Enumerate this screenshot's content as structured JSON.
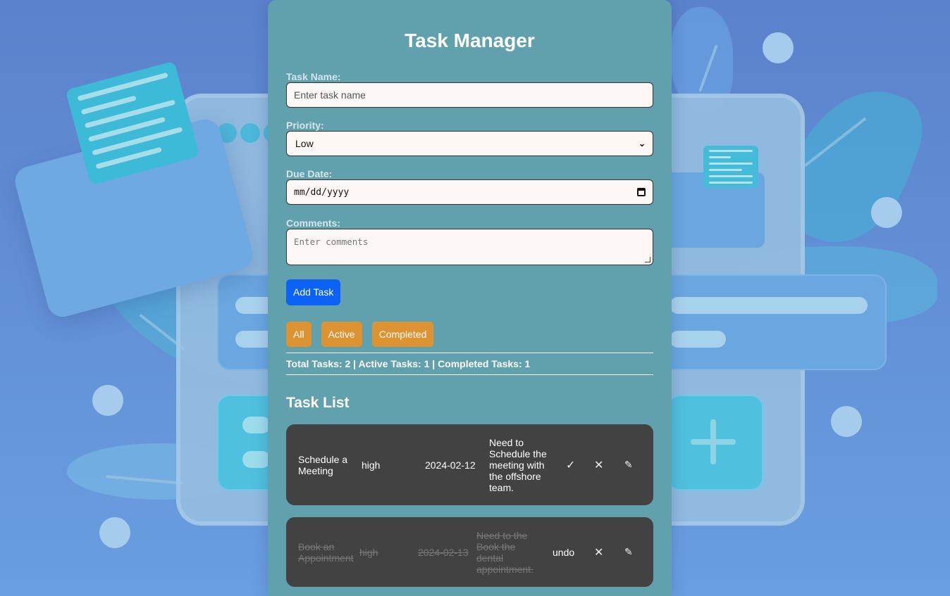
{
  "app": {
    "title": "Task Manager"
  },
  "form": {
    "task_name_label": "Task Name:",
    "task_name_placeholder": "Enter task name",
    "priority_label": "Priority:",
    "priority_value": "Low",
    "due_date_label": "Due Date:",
    "due_date_placeholder": "mm/dd/yyyy",
    "comments_label": "Comments:",
    "comments_placeholder": "Enter comments",
    "add_button": "Add Task"
  },
  "filters": [
    "All",
    "Active",
    "Completed"
  ],
  "stats": "Total Tasks: 2 | Active Tasks: 1 | Completed Tasks: 1",
  "task_list": {
    "title": "Task List",
    "tasks": [
      {
        "name": "Schedule a Meeting",
        "priority": "high",
        "due_date": "2024-02-12",
        "comments": "Need to Schedule the meeting with the offshore team.",
        "status_action": "✓",
        "completed": false
      },
      {
        "name": "Book an Appointment",
        "priority": "high",
        "due_date": "2024-02-13",
        "comments": "Need to the Book the dental appointment.",
        "status_action": "undo",
        "completed": true
      }
    ]
  },
  "icons": {
    "complete": "check-icon",
    "delete": "close-icon",
    "edit": "pencil-icon"
  },
  "colors": {
    "add_button": "#0b62f5",
    "filter_button": "#dd9332",
    "card": "#60a1ad",
    "task_row": "#424242"
  }
}
